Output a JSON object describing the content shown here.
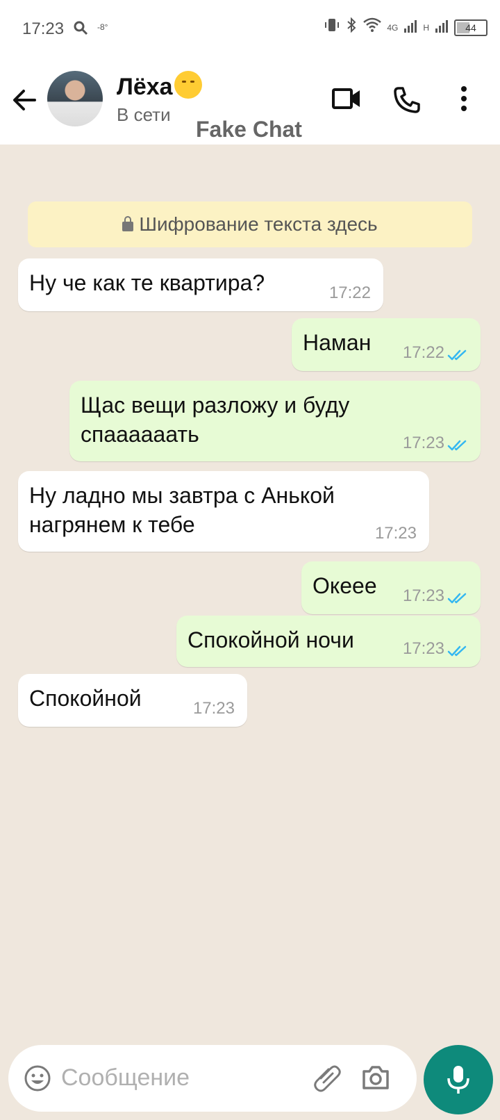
{
  "status_bar": {
    "time": "17:23",
    "temperature": "-8°",
    "network": "4G",
    "network2": "H",
    "battery": "44"
  },
  "header": {
    "contact_name": "Лёха",
    "contact_status": "В сети",
    "watermark": "Fake Chat"
  },
  "encryption_banner": "Шифрование текста здесь",
  "messages": [
    {
      "dir": "in",
      "text": "Ну че как те квартира?",
      "time": "17:22"
    },
    {
      "dir": "out",
      "text": "Наман",
      "time": "17:22"
    },
    {
      "dir": "out",
      "text_lines": [
        "Щас вещи разложу и буду",
        "спаааааать"
      ],
      "time": "17:23"
    },
    {
      "dir": "in",
      "text_lines": [
        "Ну ладно мы завтра с Анькой",
        "нагрянем к  тебе"
      ],
      "time": "17:23"
    },
    {
      "dir": "out",
      "text": "Океее",
      "time": "17:23"
    },
    {
      "dir": "out",
      "text": "Спокойной ночи",
      "time": "17:23"
    },
    {
      "dir": "in",
      "text": "Спокойной",
      "time": "17:23"
    }
  ],
  "input": {
    "placeholder": "Сообщение"
  },
  "colors": {
    "accent": "#0e8a7b",
    "outgoing_bubble": "#e7fbd5",
    "read_ticks": "#34b7f1",
    "chat_background": "#efe7dd"
  },
  "icons": [
    "back-arrow-icon",
    "video-call-icon",
    "phone-icon",
    "more-vert-icon",
    "lock-icon",
    "emoji-icon",
    "attach-icon",
    "camera-icon",
    "mic-icon",
    "double-check-icon"
  ]
}
